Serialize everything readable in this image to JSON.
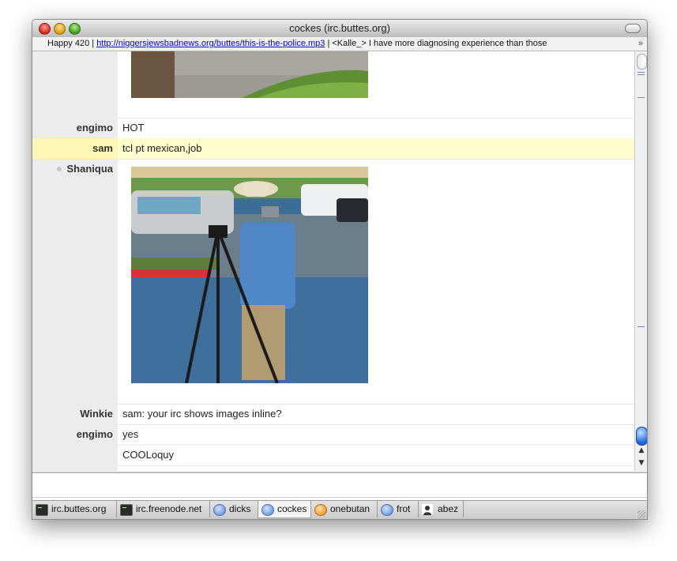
{
  "window": {
    "title": "cockes (irc.buttes.org)"
  },
  "topic": {
    "prefix": "Happy 420 | ",
    "link": "http://niggersjewsbadnews.org/buttes/this-is-the-police.mp3",
    "suffix": " | <Kalle_> I have more diagnosing experience than those",
    "more_glyph": "»"
  },
  "messages": [
    {
      "nick": "engimo",
      "text": "HOT"
    },
    {
      "nick": "sam",
      "text": "tcl pt mexican,job",
      "highlight": true
    },
    {
      "nick": "Shaniqua",
      "text": ""
    },
    {
      "nick": "Winkie",
      "text": "sam: your irc shows images inline?"
    },
    {
      "nick": "engimo",
      "text": "yes"
    },
    {
      "nick": "",
      "text": "COOLoquy"
    }
  ],
  "scroll": {
    "up_glyph": "▲",
    "down_glyph": "▼"
  },
  "tabs": [
    {
      "label": "irc.buttes.org",
      "icon": "terminal-icon"
    },
    {
      "label": "irc.freenode.net",
      "icon": "terminal-icon"
    },
    {
      "label": "dicks",
      "icon": "chat-bubble-icon"
    },
    {
      "label": "cockes",
      "icon": "chat-bubble-icon",
      "active": true
    },
    {
      "label": "onebutan",
      "icon": "chat-bubble-orange-icon"
    },
    {
      "label": "frot",
      "icon": "chat-bubble-icon"
    },
    {
      "label": "abez",
      "icon": "person-icon"
    }
  ],
  "colors": {
    "highlight_row": "#fffccd",
    "nick_column": "#ececec",
    "link": "#0000d8",
    "scroll_thumb": "#1d62d8"
  }
}
